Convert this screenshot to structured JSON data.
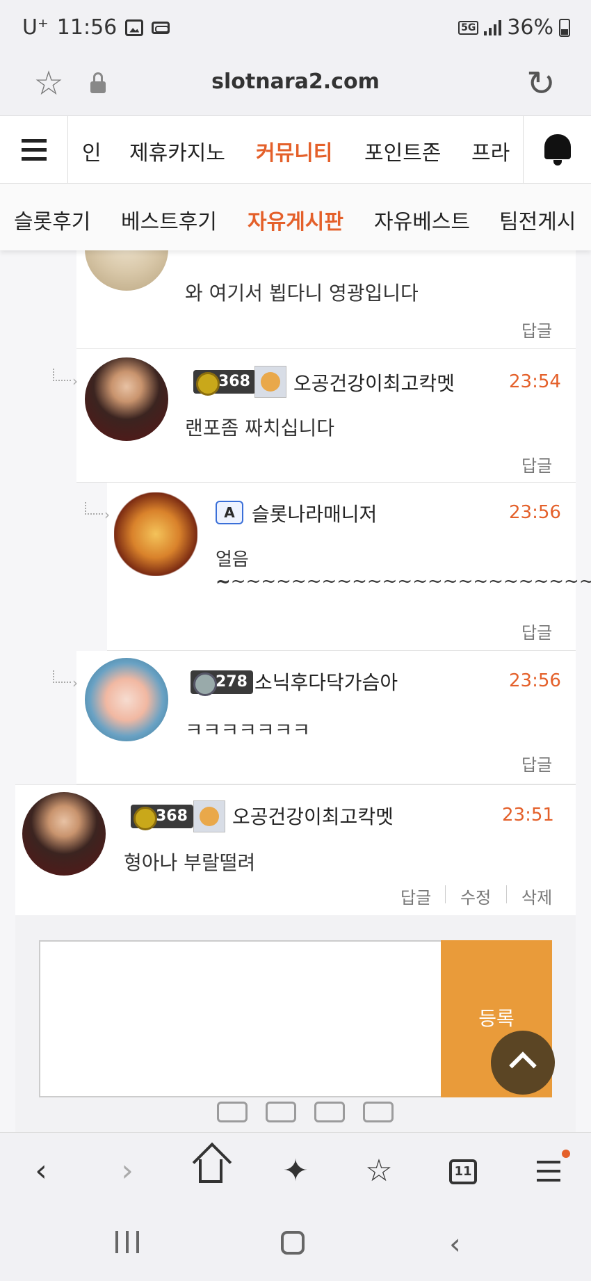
{
  "status_bar": {
    "carrier": "U⁺",
    "time": "11:56",
    "network": "5G",
    "battery": "36%"
  },
  "browser": {
    "url": "slotnara2.com"
  },
  "site_nav": {
    "items": [
      "인",
      "제휴카지노",
      "커뮤니티",
      "포인트존",
      "프라"
    ],
    "active_index": 2
  },
  "sub_nav": {
    "items": [
      "슬롯후기",
      "베스트후기",
      "자유게시판",
      "자유베스트",
      "팀전게시"
    ],
    "active_index": 2
  },
  "comments": [
    {
      "author": "",
      "time": "",
      "text": "와 여기서 뵙다니 영광입니다",
      "reply_label": "답글"
    },
    {
      "level": "368",
      "author": "오공건강이최고칵멧",
      "time": "23:54",
      "text": "랜포좀 짜치십니다",
      "reply_label": "답글"
    },
    {
      "admin_badge": "A",
      "author": "슬롯나라매니저",
      "time": "23:56",
      "text": "얼음~~~~~~~~~~~~~~~~~~~~~~~~~~~~",
      "text2": "~",
      "reply_label": "답글"
    },
    {
      "level": "278",
      "author": "소닉후다닥가슴아",
      "time": "23:56",
      "text": "ㅋㅋㅋㅋㅋㅋㅋ",
      "reply_label": "답글"
    },
    {
      "level": "368",
      "author": "오공건강이최고칵멧",
      "time": "23:51",
      "text": "형아나 부랄떨려",
      "reply_label": "답글",
      "edit_label": "수정",
      "delete_label": "삭제"
    }
  ],
  "write": {
    "submit_label": "등록"
  },
  "bottom_bar": {
    "tab_count": "11"
  },
  "colors": {
    "accent": "#e4602a",
    "submit": "#e99b3a",
    "scroll_top": "#5b4524"
  }
}
